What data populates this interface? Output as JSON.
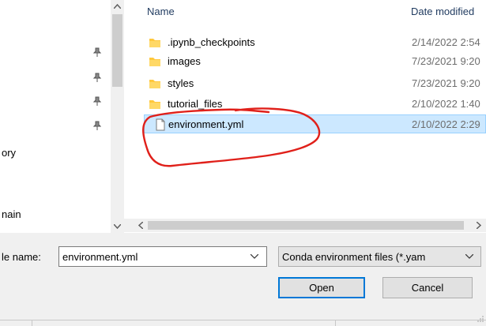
{
  "nav_pane": {
    "items": [
      {
        "label": "ory"
      },
      {
        "label": "nain"
      }
    ]
  },
  "file_list": {
    "columns": {
      "name": "Name",
      "date": "Date modified"
    },
    "rows": [
      {
        "name": ".ipynb_checkpoints",
        "date": "2/14/2022 2:54",
        "type": "folder"
      },
      {
        "name": "images",
        "date": "7/23/2021 9:20",
        "type": "folder"
      },
      {
        "name": "styles",
        "date": "7/23/2021 9:20",
        "type": "folder"
      },
      {
        "name": "tutorial_files",
        "date": "2/10/2022 1:40",
        "type": "folder"
      },
      {
        "name": "environment.yml",
        "date": "2/10/2022 2:29",
        "type": "file",
        "selected": true
      }
    ]
  },
  "bottom": {
    "file_name_label": "le name:",
    "file_name_value": "environment.yml",
    "file_type_value": "Conda environment files (*.yam",
    "open_label": "Open",
    "cancel_label": "Cancel"
  },
  "colors": {
    "selection": "#cce8ff",
    "folder": "#ffc83d",
    "annotation": "#e0201a",
    "accent": "#0078d7"
  }
}
